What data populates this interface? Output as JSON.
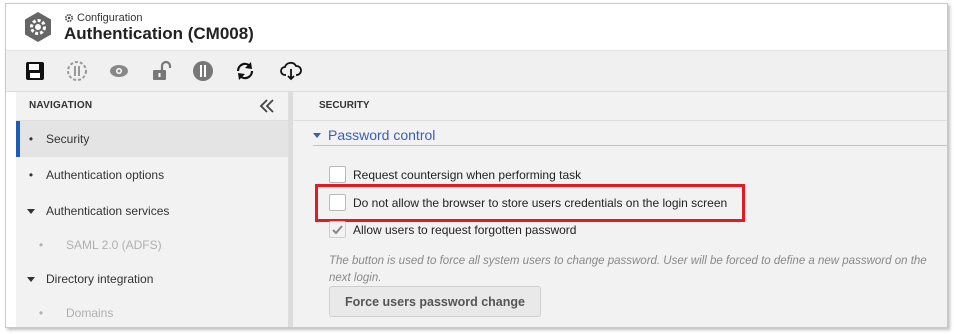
{
  "header": {
    "breadcrumb": "Configuration",
    "title": "Authentication (CM008)"
  },
  "toolbar": {
    "buttons": [
      {
        "name": "save-icon",
        "label": "Save"
      },
      {
        "name": "enable-disable-icon",
        "label": "Enable/Disable"
      },
      {
        "name": "view-icon",
        "label": "View"
      },
      {
        "name": "unlock-icon",
        "label": "Unlock"
      },
      {
        "name": "toggle-icon",
        "label": "Toggle"
      },
      {
        "name": "refresh-icon",
        "label": "Refresh"
      },
      {
        "name": "cloud-download-icon",
        "label": "Download"
      }
    ]
  },
  "navigation": {
    "header": "NAVIGATION",
    "items": [
      {
        "label": "Security",
        "marker": "•",
        "active": true
      },
      {
        "label": "Authentication options",
        "marker": "•"
      },
      {
        "label": "Authentication services",
        "marker": "triangle"
      },
      {
        "label": "SAML 2.0 (ADFS)",
        "marker": "•",
        "sub": true
      },
      {
        "label": "Directory integration",
        "marker": "triangle"
      },
      {
        "label": "Domains",
        "marker": "•",
        "sub": true
      }
    ]
  },
  "security": {
    "header": "SECURITY",
    "section_title": "Password control",
    "options": [
      {
        "label": "Request countersign when performing task",
        "checked": false
      },
      {
        "label": "Do not allow the browser to store users credentials on the login screen",
        "checked": false,
        "highlighted": true
      },
      {
        "label": "Allow users to request forgotten password",
        "checked": true
      }
    ],
    "help_text": "The button is used to force all system users to change password. User will be forced to define a new password on the next login.",
    "force_button": "Force users password change"
  },
  "colors": {
    "accent": "#1a5fb4",
    "link": "#3a5db8",
    "highlight": "#e01b24"
  }
}
